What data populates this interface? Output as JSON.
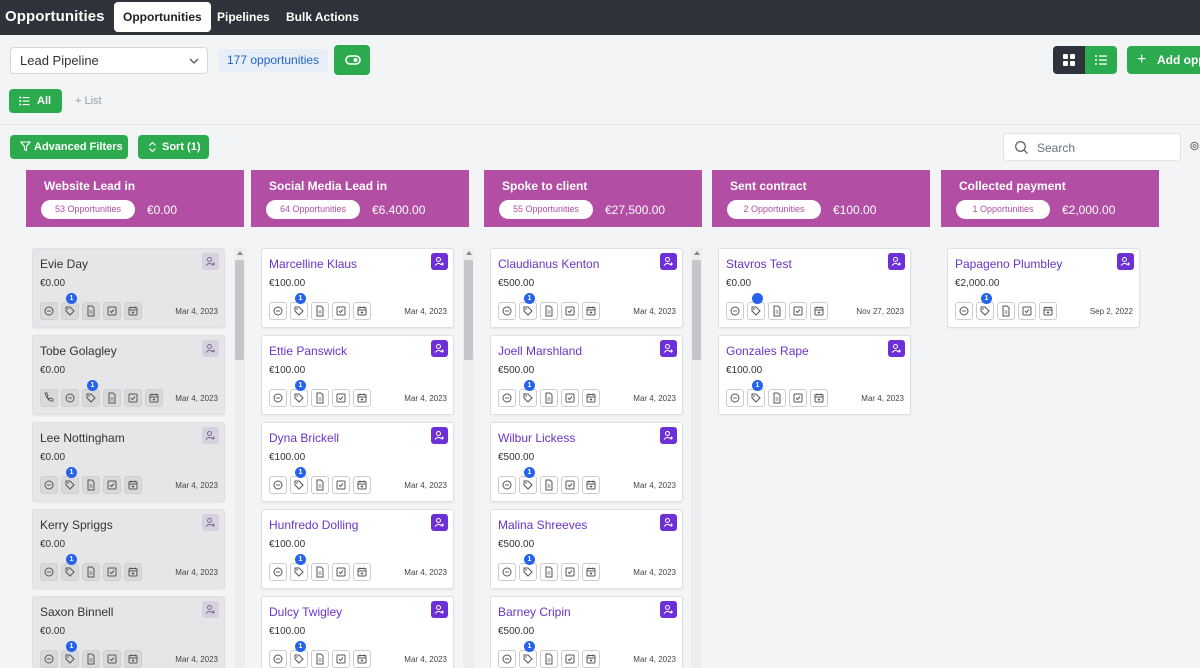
{
  "nav": {
    "title": "Opportunities",
    "tabs": [
      "Opportunities",
      "Pipelines",
      "Bulk Actions"
    ]
  },
  "controls": {
    "pipeline": "Lead Pipeline",
    "count": "177 opportunities",
    "add": "Add opp",
    "all": "All",
    "list": "+ List",
    "advanced_filters": "Advanced Filters",
    "sort": "Sort (1)",
    "search_placeholder": "Search"
  },
  "colors": {
    "accent_green": "#2bab4e",
    "stage_header": "#b24ea3",
    "link_purple": "#6a35c9",
    "badge_blue": "#2563eb"
  },
  "columns": [
    {
      "title": "Website Lead in",
      "pill": "53 Opportunities",
      "amount": "€0.00",
      "cards": [
        {
          "name": "Evie Day",
          "amount": "€0.00",
          "date": "Mar 4, 2023",
          "phone": false,
          "badge": "1"
        },
        {
          "name": "Tobe Golagley",
          "amount": "€0.00",
          "date": "Mar 4, 2023",
          "phone": true,
          "badge": "1"
        },
        {
          "name": "Lee Nottingham",
          "amount": "€0.00",
          "date": "Mar 4, 2023",
          "phone": false,
          "badge": "1"
        },
        {
          "name": "Kerry Spriggs",
          "amount": "€0.00",
          "date": "Mar 4, 2023",
          "phone": false,
          "badge": "1"
        },
        {
          "name": "Saxon Binnell",
          "amount": "€0.00",
          "date": "Mar 4, 2023",
          "phone": false,
          "badge": "1"
        }
      ]
    },
    {
      "title": "Social Media Lead in",
      "pill": "64 Opportunities",
      "amount": "€6.400.00",
      "cards": [
        {
          "name": "Marcelline Klaus",
          "amount": "€100.00",
          "date": "Mar 4, 2023",
          "phone": false,
          "badge": "1"
        },
        {
          "name": "Ettie Panswick",
          "amount": "€100.00",
          "date": "Mar 4, 2023",
          "phone": false,
          "badge": "1"
        },
        {
          "name": "Dyna Brickell",
          "amount": "€100.00",
          "date": "Mar 4, 2023",
          "phone": false,
          "badge": "1"
        },
        {
          "name": "Hunfredo Dolling",
          "amount": "€100.00",
          "date": "Mar 4, 2023",
          "phone": false,
          "badge": "1"
        },
        {
          "name": "Dulcy Twigley",
          "amount": "€100.00",
          "date": "Mar 4, 2023",
          "phone": false,
          "badge": "1"
        }
      ]
    },
    {
      "title": "Spoke to client",
      "pill": "55 Opportunities",
      "amount": "€27,500.00",
      "cards": [
        {
          "name": "Claudianus Kenton",
          "amount": "€500.00",
          "date": "Mar 4, 2023",
          "phone": false,
          "badge": "1"
        },
        {
          "name": "Joell Marshland",
          "amount": "€500.00",
          "date": "Mar 4, 2023",
          "phone": false,
          "badge": "1"
        },
        {
          "name": "Wilbur Lickess",
          "amount": "€500.00",
          "date": "Mar 4, 2023",
          "phone": false,
          "badge": "1"
        },
        {
          "name": "Malina Shreeves",
          "amount": "€500.00",
          "date": "Mar 4, 2023",
          "phone": false,
          "badge": "1"
        },
        {
          "name": "Barney Cripin",
          "amount": "€500.00",
          "date": "Mar 4, 2023",
          "phone": false,
          "badge": "1"
        }
      ]
    },
    {
      "title": "Sent contract",
      "pill": "2 Opportunities",
      "amount": "€100.00",
      "cards": [
        {
          "name": "Stavros Test",
          "amount": "€0.00",
          "date": "Nov 27, 2023",
          "phone": false,
          "badge": ""
        },
        {
          "name": "Gonzales Rape",
          "amount": "€100.00",
          "date": "Mar 4, 2023",
          "phone": false,
          "badge": "1"
        }
      ]
    },
    {
      "title": "Collected payment",
      "pill": "1 Opportunities",
      "amount": "€2,000.00",
      "cards": [
        {
          "name": "Papageno Plumbley",
          "amount": "€2,000.00",
          "date": "Sep 2, 2022",
          "phone": false,
          "badge": "1"
        }
      ]
    }
  ]
}
